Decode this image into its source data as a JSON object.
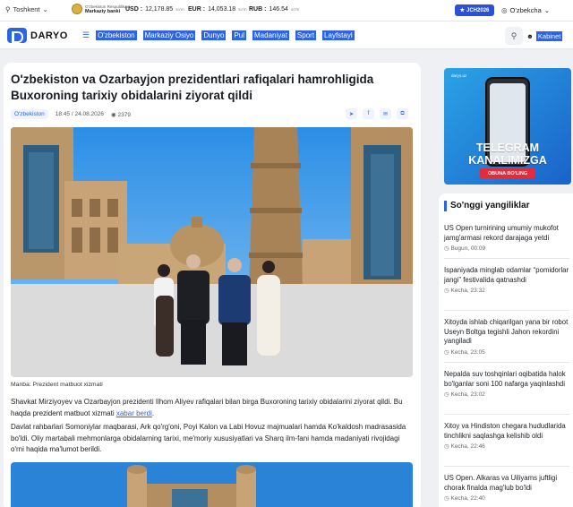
{
  "topbar": {
    "location": "Toshkent",
    "cbu_line1": "O'zbekiston Respublikasi",
    "cbu_line2": "Markaziy banki",
    "rates": [
      {
        "currency": "USD :",
        "value": "12,178.85",
        "unit": "so'm"
      },
      {
        "currency": "EUR :",
        "value": "14,053.18",
        "unit": "so'm"
      },
      {
        "currency": "RUB :",
        "value": "146.54",
        "unit": "so'm"
      }
    ],
    "badge": "JCH2026",
    "language": "O'zbekcha"
  },
  "nav": {
    "logo": "DARYO",
    "menu": [
      "O'zbekiston",
      "Markaziy Osiyo",
      "Dunyo",
      "Pul",
      "Madaniyat",
      "Sport",
      "Layfstayl"
    ],
    "account": "Kabinet"
  },
  "article": {
    "title": "O'zbekiston va Ozarbayjon prezidentlari rafiqalari hamrohligida Buxoroning tarixiy obidalarini ziyorat qildi",
    "category": "O'zbekiston",
    "datetime": "18:45 / 24.08.2026",
    "views": "2379",
    "caption": "Manba: Prezident matbuot xizmati",
    "paragraph1": "Shavkat Mirziyoyev va Ozarbayjon prezidenti Ilhom Aliyev rafiqalari bilan birga Buxoroning tarixiy obidalarini ziyorat qildi. Bu haqda prezident matbuot xizmati",
    "paragraph1_link": "xabar berdi",
    "paragraph1_end": ".",
    "paragraph2": "Davlat rahbarlari Somoniylar maqbarasi, Ark qo'rg'oni, Poyi Kalon va Labi Hovuz majmualari hamda Ko'kaldosh madrasasida bo'ldi. Oliy martabali mehmonlarga obidalarning tarixi, me'moriy xususiyatlari va Sharq ilm-fani hamda madaniyati rivojidagi o'rni haqida ma'lumot berildi."
  },
  "promo": {
    "brand": "daryo.uz",
    "title": "TELEGRAM KANALIMIZGA",
    "button": "OBUNA BO'LING"
  },
  "latest": {
    "title": "So'nggi yangiliklar",
    "items": [
      {
        "text": "US Open turnirining umumiy mukofot jamg'armasi rekord darajaga yetdi",
        "time": "Bugun, 00:09"
      },
      {
        "text": "Ispaniyada minglab odamlar “pomidorlar jangi” festivalida qatnashdi",
        "time": "Kecha, 23:32"
      },
      {
        "text": "Xitoyda ishlab chiqarilgan yana bir robot Useyn Boltga tegishli Jahon rekordini yangiladi",
        "time": "Kecha, 23:05"
      },
      {
        "text": "Nepalda suv toshqinlari oqibatida halok bo'lganlar soni 100 nafarga yaqinlashdi",
        "time": "Kecha, 23:02"
      },
      {
        "text": "Xitoy va Hindiston chegara hududlarida tinchlikni saqlashga kelishib oldi",
        "time": "Kecha, 22:46"
      },
      {
        "text": "US Open. Alkaras va Uiliyams juftligi chorak finalda mag'lub bo'ldi",
        "time": "Kecha, 22:40"
      }
    ]
  }
}
